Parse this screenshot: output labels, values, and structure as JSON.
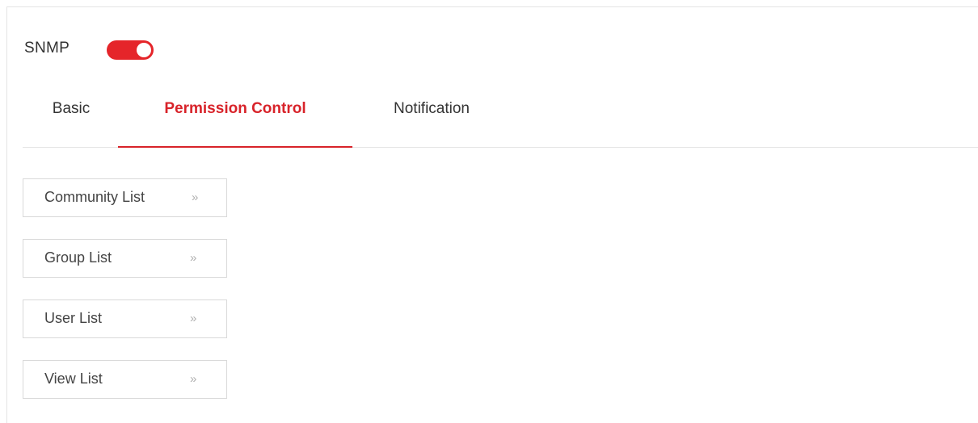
{
  "snmp": {
    "label": "SNMP",
    "enabled": true,
    "toggle_color": "#e5252a"
  },
  "tabs": [
    {
      "label": "Basic",
      "active": false
    },
    {
      "label": "Permission Control",
      "active": true
    },
    {
      "label": "Notification",
      "active": false
    }
  ],
  "accent_color": "#d8232a",
  "lists": [
    {
      "label": "Community List",
      "icon": "double-chevron-right-icon",
      "glyph": "»"
    },
    {
      "label": "Group List",
      "icon": "double-chevron-right-icon",
      "glyph": "»"
    },
    {
      "label": "User List",
      "icon": "double-chevron-right-icon",
      "glyph": "»"
    },
    {
      "label": "View List",
      "icon": "double-chevron-right-icon",
      "glyph": "»"
    }
  ]
}
